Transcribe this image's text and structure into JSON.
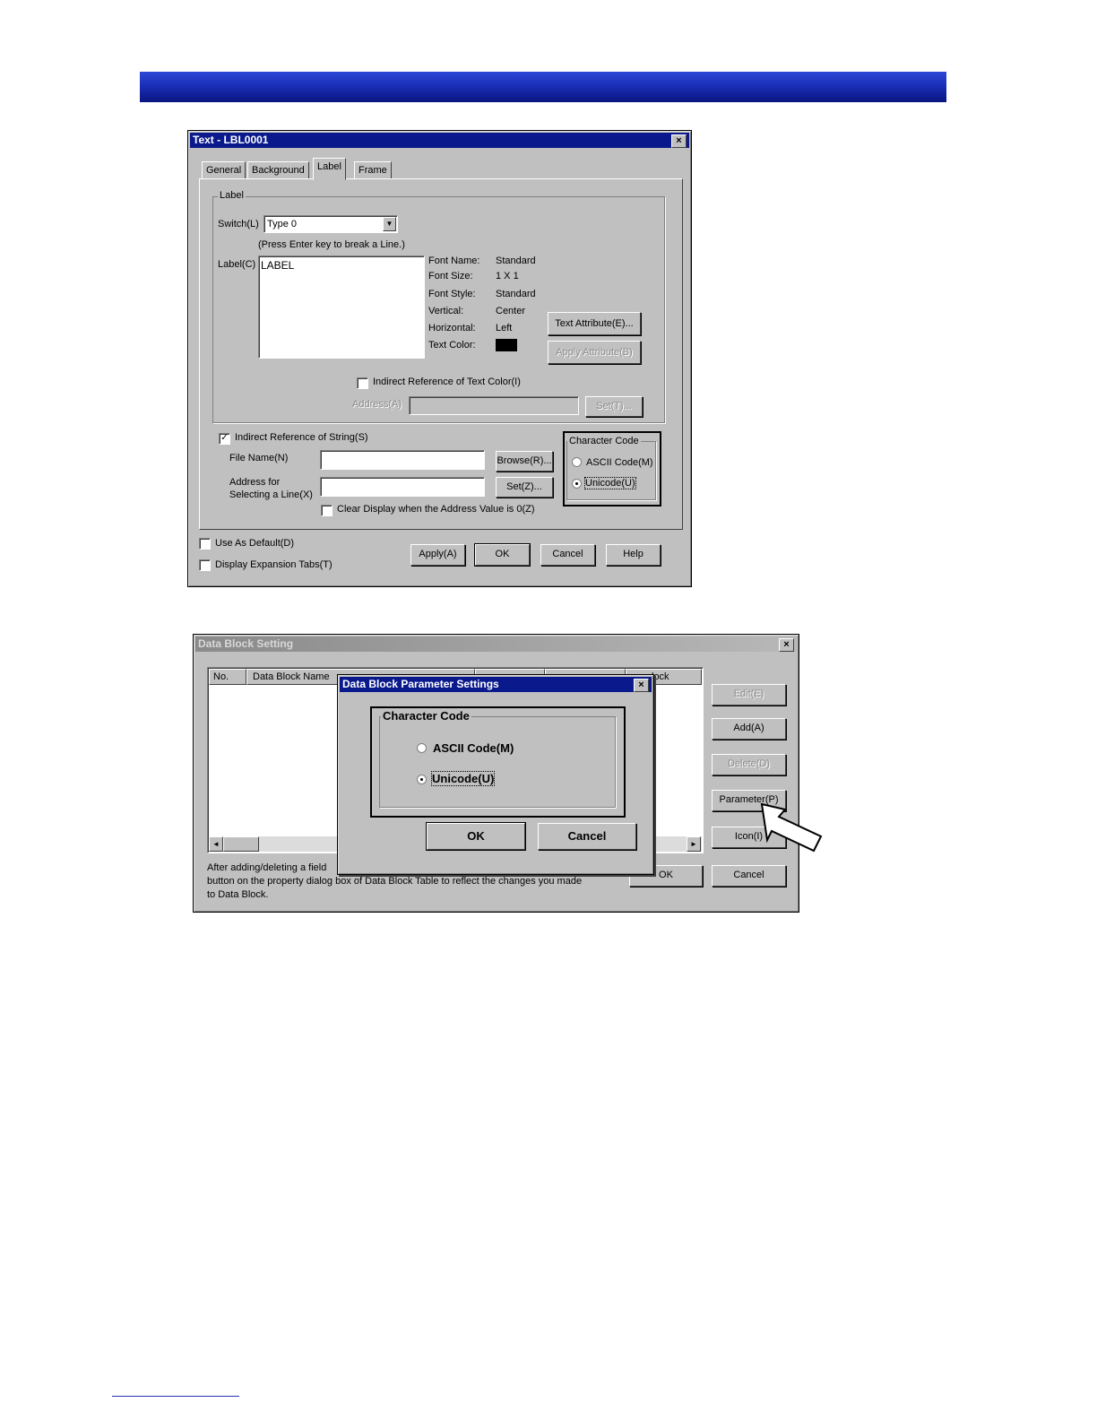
{
  "dialog1": {
    "title": "Text - LBL0001",
    "close": "×",
    "tabs": [
      "General",
      "Background",
      "Label",
      "Frame"
    ],
    "label_group": "Label",
    "switch_label": "Switch(L)",
    "switch_value": "Type 0",
    "press_enter_hint": "(Press Enter key to break a Line.)",
    "label_field_label": "Label(C)",
    "label_value": "LABEL",
    "font_name_label": "Font Name:",
    "font_name_value": "Standard",
    "font_size_label": "Font Size:",
    "font_size_value": "1 X 1",
    "font_style_label": "Font Style:",
    "font_style_value": "Standard",
    "vertical_label": "Vertical:",
    "vertical_value": "Center",
    "horizontal_label": "Horizontal:",
    "horizontal_value": "Left",
    "text_color_label": "Text Color:",
    "text_color_swatch": "#000000",
    "text_attribute_button": "Text Attribute(E)...",
    "apply_attribute_button": "Apply Attribute(B)",
    "indirect_color_check": "Indirect Reference of Text Color(I)",
    "address_label": "Address(A)",
    "set_button_1": "Set(T)...",
    "indirect_string_check": "Indirect Reference of String(S)",
    "file_name_label": "File Name(N)",
    "browse_button": "Browse(R)...",
    "address_line1": "Address for",
    "address_line2": "Selecting a Line(X)",
    "set_button_2": "Set(Z)...",
    "clear_display_check": "Clear Display when the Address Value is 0(Z)",
    "char_code_group": "Character Code",
    "ascii_radio": "ASCII Code(M)",
    "unicode_radio": "Unicode(U)",
    "use_default_check": "Use As Default(D)",
    "display_tabs_check": "Display Expansion Tabs(T)",
    "apply_button": "Apply(A)",
    "ok_button": "OK",
    "cancel_button": "Cancel",
    "help_button": "Help"
  },
  "dialog2": {
    "title": "Data Block Setting",
    "close": "×",
    "col_no": "No.",
    "col_name": "Data Block Name",
    "col_last": "lock",
    "edit_button": "Edit(E)",
    "add_button": "Add(A)",
    "delete_button": "Delete(D)",
    "parameter_button": "Parameter(P)",
    "icon_button": "Icon(I)",
    "ok_button": "OK",
    "cancel_button": "Cancel",
    "footer_line1": "After adding/deleting a field",
    "footer_line2": "button on the property dialog box of Data Block Table to reflect the changes you made",
    "footer_line3": "to Data Block.",
    "scroll_left": "◄",
    "scroll_right": "►"
  },
  "dialog3": {
    "title": "Data Block Parameter Settings",
    "close": "×",
    "group": "Character Code",
    "ascii_radio": "ASCII Code(M)",
    "unicode_radio": "Unicode(U)",
    "ok_button": "OK",
    "cancel_button": "Cancel"
  },
  "colors": {
    "banner": "#1a2fb8",
    "titlebar_active": "#0a1a8c",
    "dialog_bg": "#c0c0c0"
  }
}
